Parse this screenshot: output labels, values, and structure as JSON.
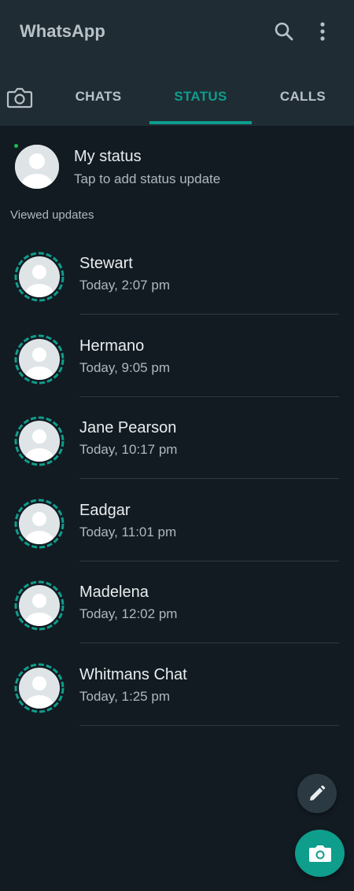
{
  "app": {
    "title": "WhatsApp",
    "accent_color": "#0f9d8c",
    "background_color": "#121b22",
    "header_color": "#1f2c34"
  },
  "header": {
    "icons": [
      "search-icon",
      "more-vertical-icon"
    ]
  },
  "tabs": [
    {
      "label": "CHATS",
      "active": false
    },
    {
      "label": "STATUS",
      "active": true
    },
    {
      "label": "CALLS",
      "active": false
    }
  ],
  "my_status": {
    "name": "My status",
    "subtitle": "Tap to add status update"
  },
  "section": {
    "viewed_label": "Viewed updates"
  },
  "statuses": [
    {
      "name": "Stewart",
      "time": "Today, 2:07 pm"
    },
    {
      "name": "Hermano",
      "time": "Today, 9:05 pm"
    },
    {
      "name": "Jane Pearson",
      "time": "Today, 10:17 pm"
    },
    {
      "name": "Eadgar",
      "time": "Today, 11:01 pm"
    },
    {
      "name": "Madelena",
      "time": "Today, 12:02 pm"
    },
    {
      "name": "Whitmans Chat",
      "time": "Today, 1:25 pm"
    }
  ],
  "fabs": {
    "secondary_icon": "pencil-icon",
    "primary_icon": "camera-icon"
  }
}
